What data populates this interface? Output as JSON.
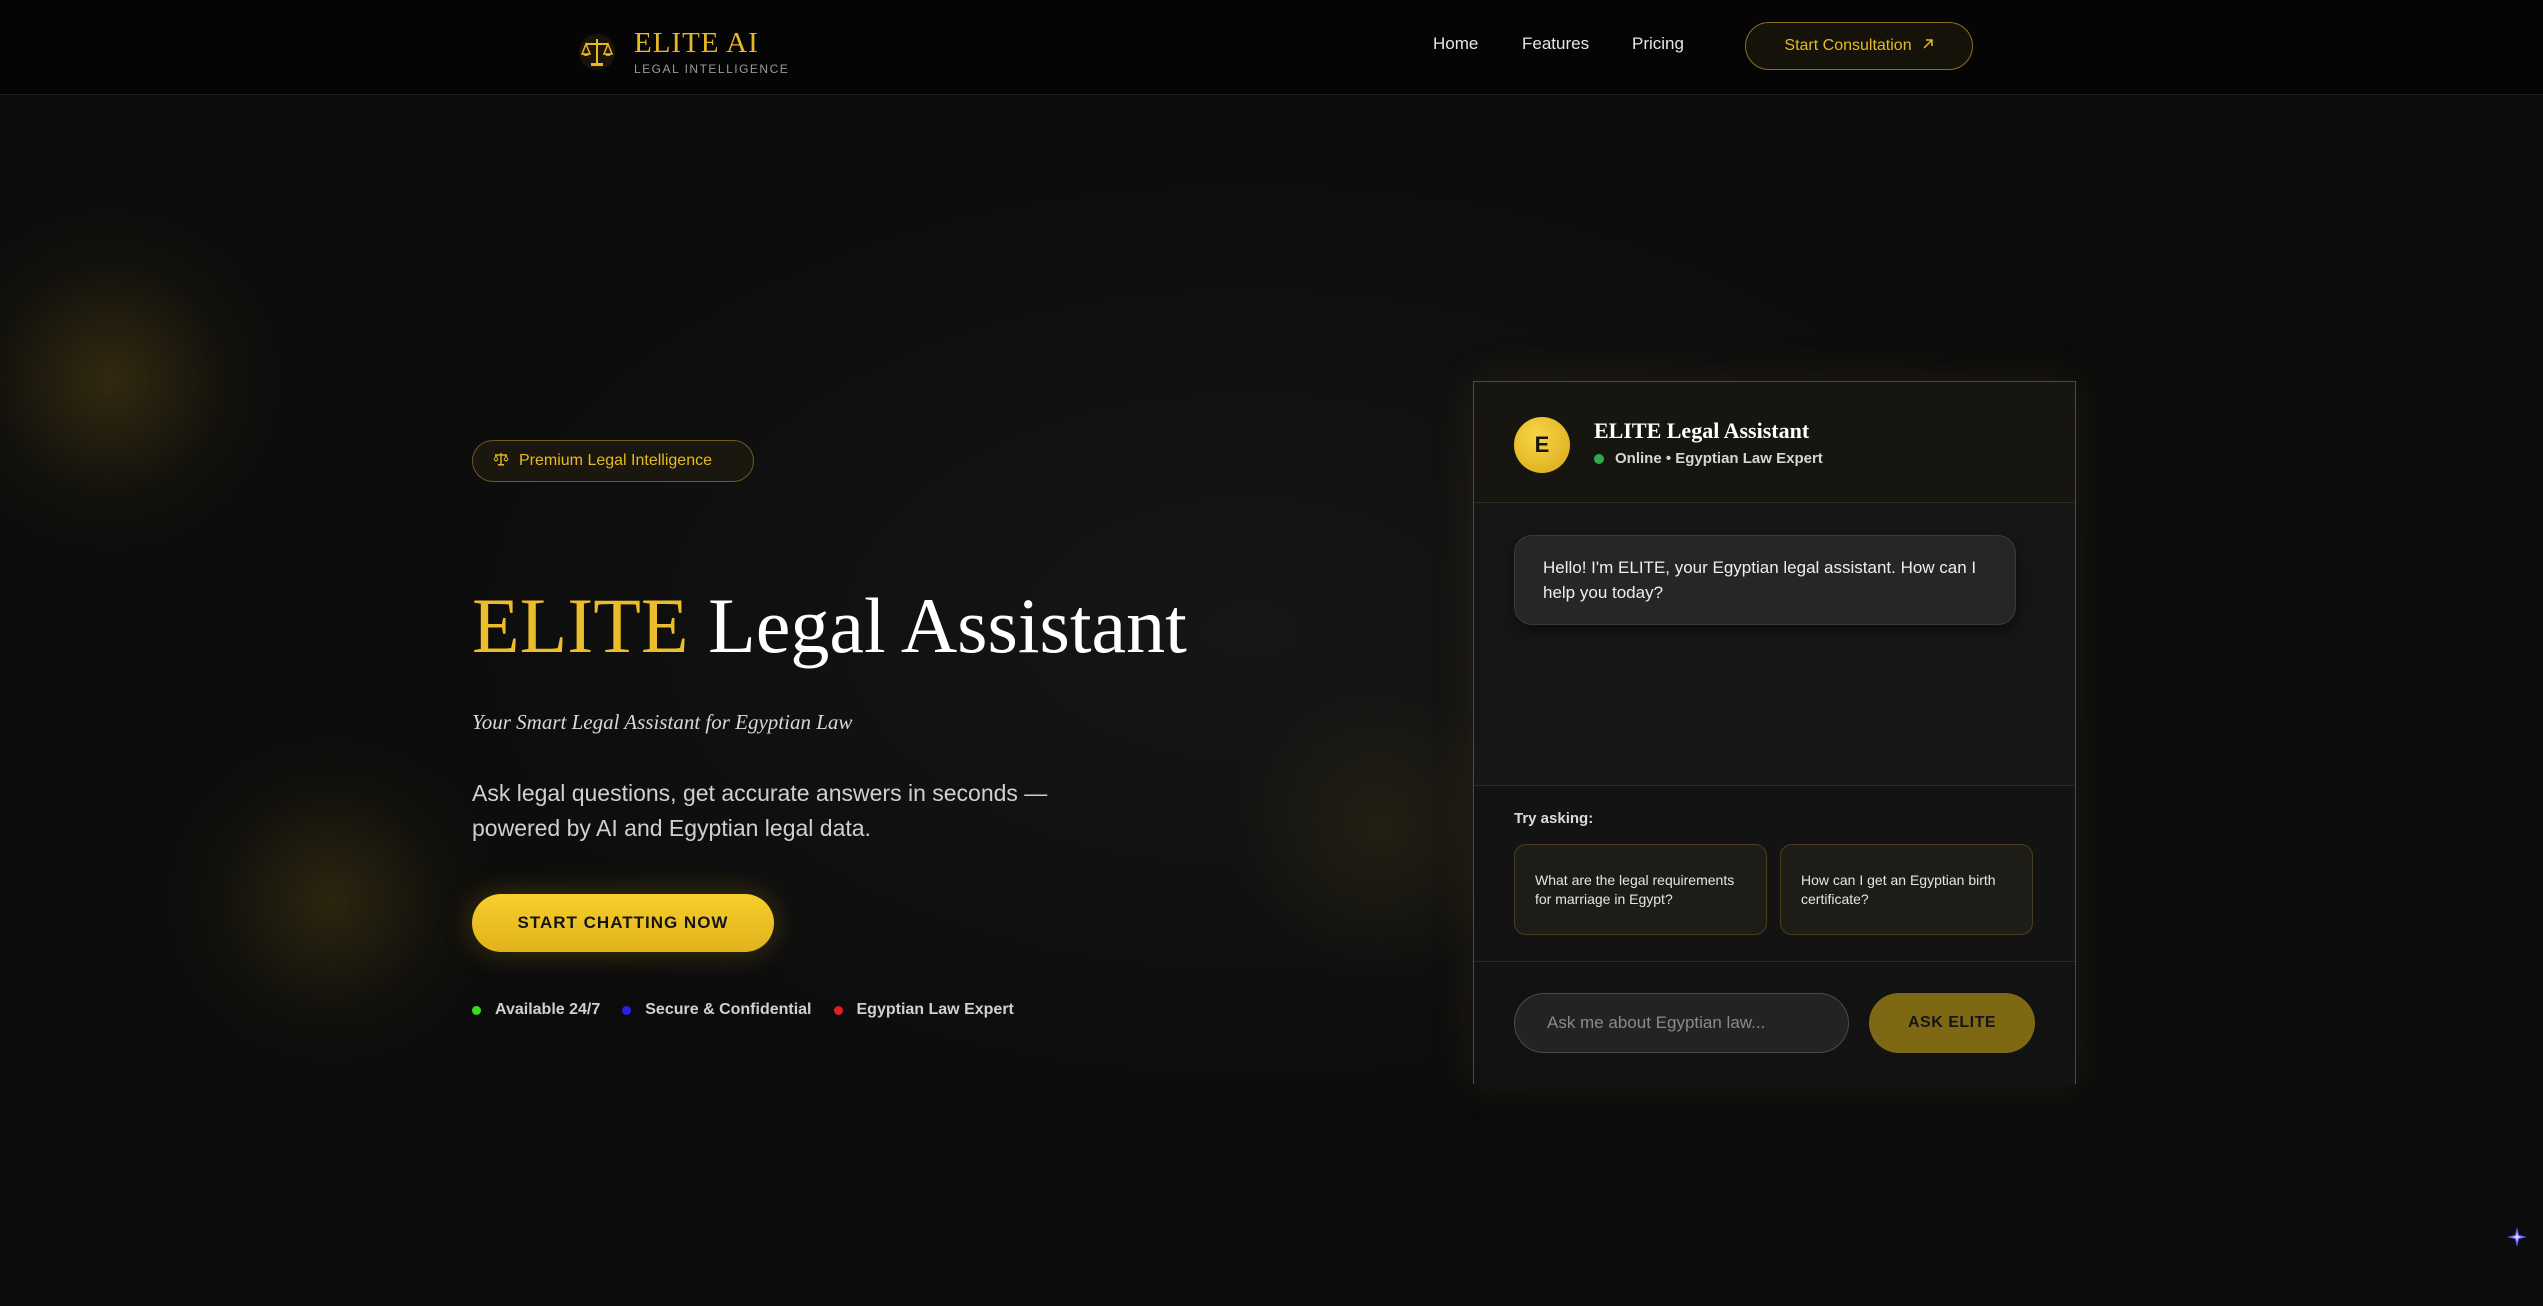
{
  "header": {
    "logo_title": "ELITE AI",
    "logo_subtitle": "LEGAL INTELLIGENCE",
    "nav": [
      {
        "label": "Home"
      },
      {
        "label": "Features"
      },
      {
        "label": "Pricing"
      }
    ],
    "cta_label": "Start Consultation",
    "cta_icon": "arrow-up-right-icon"
  },
  "hero": {
    "badge_label": "Premium Legal Intelligence",
    "badge_icon": "scales-icon",
    "title_highlight": "ELITE",
    "title_rest": "Legal Assistant",
    "tagline": "Your Smart Legal Assistant for Egyptian Law",
    "description": "Ask legal questions, get accurate answers in seconds — powered by AI and Egyptian legal data.",
    "cta_label": "START CHATTING NOW",
    "features": [
      {
        "label": "Available 24/7",
        "color": "#3cdc1c"
      },
      {
        "label": "Secure & Confidential",
        "color": "#2424e6"
      },
      {
        "label": "Egyptian Law Expert",
        "color": "#e02020"
      }
    ]
  },
  "chat": {
    "avatar_letter": "E",
    "name": "ELITE Legal Assistant",
    "status": "Online • Egyptian Law Expert",
    "status_color": "#2fa84f",
    "messages": [
      {
        "sender": "assistant",
        "text": "Hello! I'm ELITE, your Egyptian legal assistant. How can I help you today?"
      }
    ],
    "try_label": "Try asking:",
    "suggestions": [
      {
        "text": "What are the legal requirements for marriage in Egypt?"
      },
      {
        "text": "How can I get an Egyptian birth certificate?"
      }
    ],
    "input_placeholder": "Ask me about Egyptian law...",
    "send_label": "ASK ELITE"
  },
  "theme": {
    "accent": "#e8b923",
    "background": "#0c0c0c"
  }
}
